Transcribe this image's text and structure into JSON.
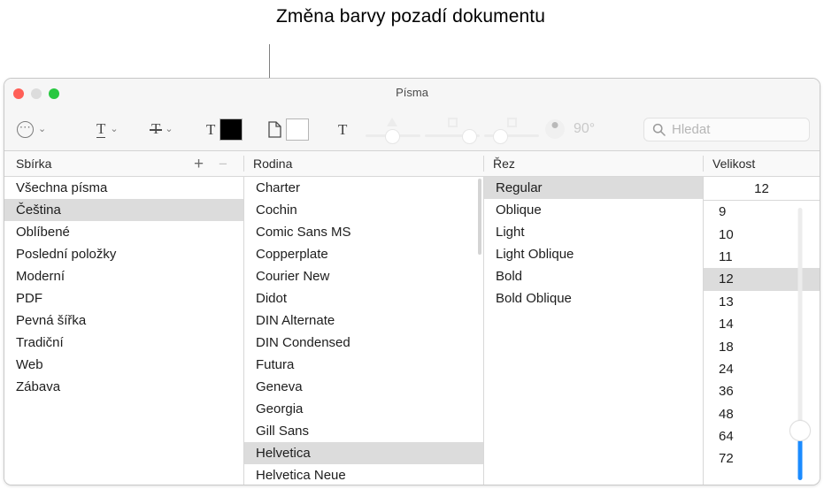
{
  "callout": {
    "text": "Změna barvy pozadí dokumentu"
  },
  "window": {
    "title": "Písma",
    "controls": {
      "close": "close-button",
      "minimize": "minimize-button",
      "zoom": "zoom-button"
    }
  },
  "toolbar": {
    "actions_menu_label": "⋯",
    "chevron": "⌄",
    "underline_glyph": "T",
    "strikethrough_glyph": "T",
    "text_color_glyph": "T",
    "text_color": "#000000",
    "document_background_color": "#ffffff",
    "shadow_glyph": "T",
    "shadow_angle": "90°",
    "search_placeholder": "Hledat",
    "search_value": ""
  },
  "columns": {
    "collection": "Sbírka",
    "family": "Rodina",
    "typeface": "Řez",
    "size": "Velikost",
    "add_label": "+",
    "remove_label": "−"
  },
  "collections": {
    "items": [
      "Všechna písma",
      "Čeština",
      "Oblíbené",
      "Poslední položky",
      "Moderní",
      "PDF",
      "Pevná šířka",
      "Tradiční",
      "Web",
      "Zábava"
    ],
    "selected": "Čeština"
  },
  "families": {
    "items": [
      "Charter",
      "Cochin",
      "Comic Sans MS",
      "Copperplate",
      "Courier New",
      "Didot",
      "DIN Alternate",
      "DIN Condensed",
      "Futura",
      "Geneva",
      "Georgia",
      "Gill Sans",
      "Helvetica",
      "Helvetica Neue"
    ],
    "selected": "Helvetica"
  },
  "typefaces": {
    "items": [
      "Regular",
      "Oblique",
      "Light",
      "Light Oblique",
      "Bold",
      "Bold Oblique"
    ],
    "selected": "Regular"
  },
  "sizes": {
    "field_value": "12",
    "items": [
      "9",
      "10",
      "11",
      "12",
      "13",
      "14",
      "18",
      "24",
      "36",
      "48",
      "64",
      "72"
    ],
    "selected": "12",
    "slider_accent": "#1b8bff"
  }
}
